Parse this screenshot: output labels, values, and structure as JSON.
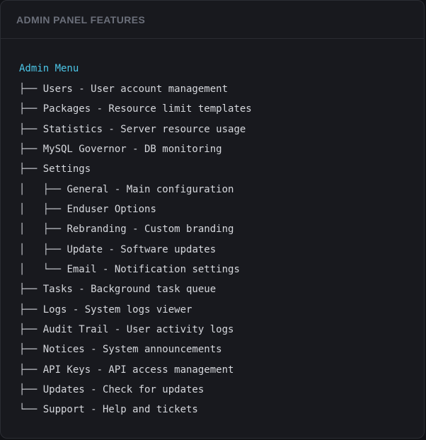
{
  "header": {
    "title": "ADMIN PANEL FEATURES"
  },
  "tree": {
    "root": "Admin Menu",
    "lines": [
      {
        "prefix": "├── ",
        "text": "Users - User account management"
      },
      {
        "prefix": "├── ",
        "text": "Packages - Resource limit templates"
      },
      {
        "prefix": "├── ",
        "text": "Statistics - Server resource usage"
      },
      {
        "prefix": "├── ",
        "text": "MySQL Governor - DB monitoring"
      },
      {
        "prefix": "├── ",
        "text": "Settings"
      },
      {
        "prefix": "│   ├── ",
        "text": "General - Main configuration"
      },
      {
        "prefix": "│   ├── ",
        "text": "Enduser Options"
      },
      {
        "prefix": "│   ├── ",
        "text": "Rebranding - Custom branding"
      },
      {
        "prefix": "│   ├── ",
        "text": "Update - Software updates"
      },
      {
        "prefix": "│   └── ",
        "text": "Email - Notification settings"
      },
      {
        "prefix": "├── ",
        "text": "Tasks - Background task queue"
      },
      {
        "prefix": "├── ",
        "text": "Logs - System logs viewer"
      },
      {
        "prefix": "├── ",
        "text": "Audit Trail - User activity logs"
      },
      {
        "prefix": "├── ",
        "text": "Notices - System announcements"
      },
      {
        "prefix": "├── ",
        "text": "API Keys - API access management"
      },
      {
        "prefix": "├── ",
        "text": "Updates - Check for updates"
      },
      {
        "prefix": "└── ",
        "text": "Support - Help and tickets"
      }
    ]
  },
  "colors": {
    "background": "#18191e",
    "title": "#6b6f7a",
    "root": "#4cc6e8",
    "text": "#d6d8dd"
  }
}
